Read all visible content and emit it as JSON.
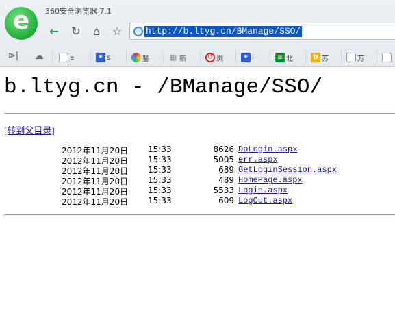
{
  "window": {
    "app_title": "360安全浏览器 7.1"
  },
  "toolbar": {
    "back_icon": "arrow-left-icon",
    "reload_icon": "reload-icon",
    "home_icon": "home-icon",
    "star_icon": "star-icon",
    "url": "http://b.ltyg.cn/BManage/SSO/"
  },
  "bookmarks": [
    {
      "label": "E",
      "icon": "page-icon"
    },
    {
      "label": "s",
      "icon": "baidu-paw-icon"
    },
    {
      "label": "鉴",
      "icon": "colorful-circle-icon"
    },
    {
      "label": "新",
      "icon": "grid-icon"
    },
    {
      "label": "浏",
      "icon": "red-circle-icon"
    },
    {
      "label": "i",
      "icon": "baidu-paw-icon"
    },
    {
      "label": "北",
      "icon": "green-square-icon"
    },
    {
      "label": "苏",
      "icon": "bing-icon"
    },
    {
      "label": "万",
      "icon": "page-icon"
    },
    {
      "label": "",
      "icon": "page-icon"
    }
  ],
  "page": {
    "heading": "b.ltyg.cn - /BManage/SSO/",
    "parent_link": "[转到父目录]",
    "files": [
      {
        "date": "2012年11月20日",
        "time": "15:33",
        "size": "8626",
        "name": "DoLogin.aspx"
      },
      {
        "date": "2012年11月20日",
        "time": "15:33",
        "size": "5005",
        "name": "err.aspx"
      },
      {
        "date": "2012年11月20日",
        "time": "15:33",
        "size": "689",
        "name": "GetLoginSession.aspx"
      },
      {
        "date": "2012年11月20日",
        "time": "15:33",
        "size": "489",
        "name": "HomePage.aspx"
      },
      {
        "date": "2012年11月20日",
        "time": "15:33",
        "size": "5533",
        "name": "Login.aspx"
      },
      {
        "date": "2012年11月20日",
        "time": "15:33",
        "size": "609",
        "name": "LogOut.aspx"
      }
    ]
  }
}
